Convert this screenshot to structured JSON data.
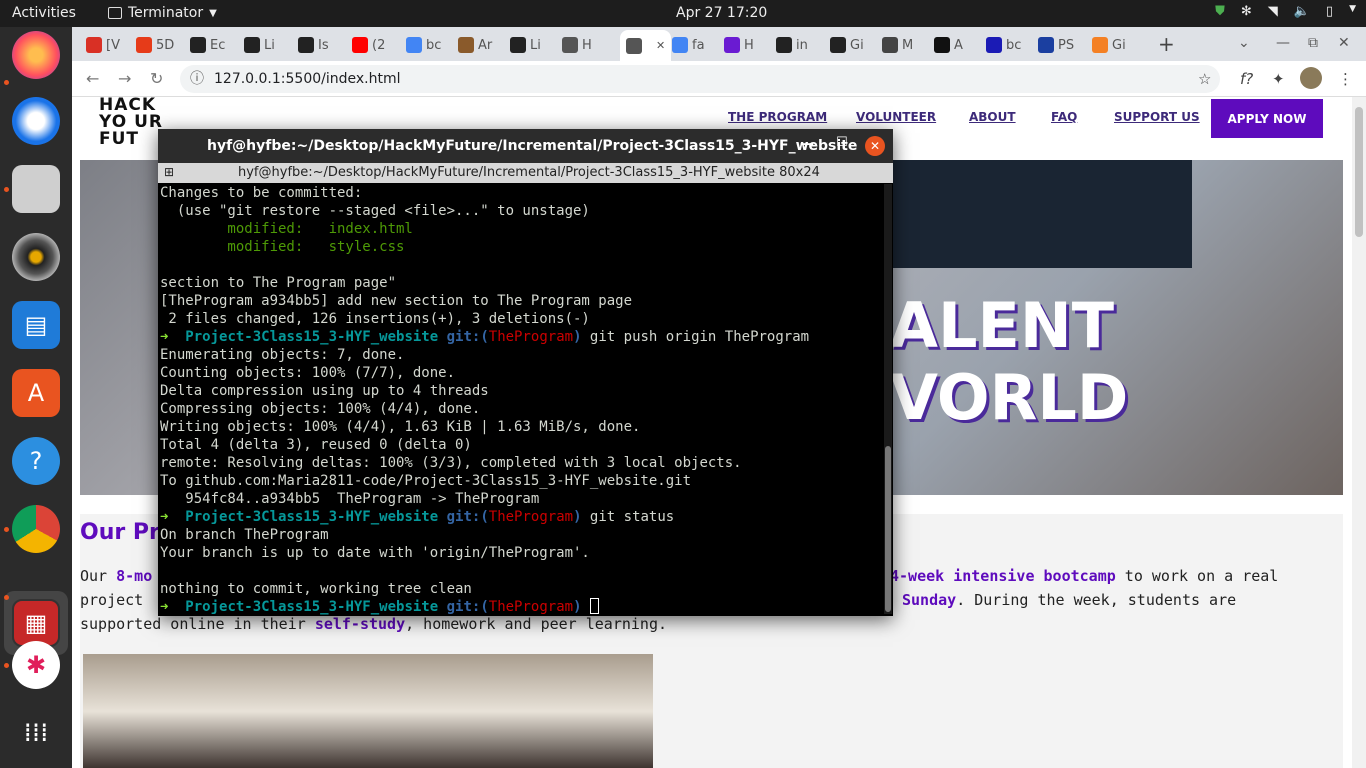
{
  "topbar": {
    "activities": "Activities",
    "app": "Terminator",
    "clock": "Apr 27  17:20"
  },
  "dock": {
    "items": [
      "firefox-icon",
      "thunderbird-icon",
      "files-icon",
      "rhythmbox-icon",
      "writer-icon",
      "software-icon",
      "help-icon",
      "chrome-icon",
      "terminator-icon",
      "slack-icon",
      "apps-grid-icon"
    ]
  },
  "browser": {
    "tabs": [
      {
        "label": "[V",
        "icon": "gmail-icon",
        "color": "#d93025"
      },
      {
        "label": "5D",
        "icon": "opera-icon",
        "color": "#e63b19"
      },
      {
        "label": "Ec",
        "icon": "github-icon",
        "color": "#222222"
      },
      {
        "label": "Li",
        "icon": "github-icon",
        "color": "#222222"
      },
      {
        "label": "Is",
        "icon": "github-icon",
        "color": "#222222"
      },
      {
        "label": "(2",
        "icon": "youtube-icon",
        "color": "#ff0000"
      },
      {
        "label": "bc",
        "icon": "google-icon",
        "color": "#4285f4"
      },
      {
        "label": "Ar",
        "icon": "bookmark-icon",
        "color": "#8a5a2b"
      },
      {
        "label": "Li",
        "icon": "p-icon",
        "color": "#222222"
      },
      {
        "label": "H",
        "icon": "globe-icon",
        "color": "#555555"
      },
      {
        "label": "",
        "icon": "globe-icon",
        "color": "#555555"
      },
      {
        "label": "fa",
        "icon": "google-icon",
        "color": "#4285f4"
      },
      {
        "label": "H",
        "icon": "video-icon",
        "color": "#6a1bd2"
      },
      {
        "label": "in",
        "icon": "github-icon",
        "color": "#222222"
      },
      {
        "label": "Gi",
        "icon": "github-icon",
        "color": "#222222"
      },
      {
        "label": "M",
        "icon": "doc-icon",
        "color": "#444444"
      },
      {
        "label": "A",
        "icon": "media-icon",
        "color": "#111111"
      },
      {
        "label": "bc",
        "icon": "bol-icon",
        "color": "#1b1bb5"
      },
      {
        "label": "PS",
        "icon": "playstation-icon",
        "color": "#1b3fa0"
      },
      {
        "label": "Gi",
        "icon": "stack-icon",
        "color": "#f48024"
      }
    ],
    "url": "127.0.0.1:5500/index.html"
  },
  "site": {
    "logo_lines": [
      "HACK",
      "YO  UR",
      "FUT"
    ],
    "nav": [
      "THE PROGRAM",
      "VOLUNTEER",
      "ABOUT",
      "FAQ",
      "SUPPORT US"
    ],
    "apply": "APPLY NOW",
    "hero_line1": "ALENT",
    "hero_line2": "VORLD",
    "section_title": "Our Pro",
    "para": {
      "l1a": "Our ",
      "l1b": "8-mo",
      "l1c": "4-week intensive bootcamp",
      "l1d": " to work on a real",
      "l2a": "project",
      "l2b": "Sunday",
      "l2c": ". During the week, students are",
      "l3a": "supported online in their ",
      "l3b": "self-study",
      "l3c": ", homework and peer learning."
    }
  },
  "terminal": {
    "title": "hyf@hyfbe:~/Desktop/HackMyFuture/Incremental/Project-3Class15_3-HYF_website",
    "subtitle": "hyf@hyfbe:~/Desktop/HackMyFuture/Incremental/Project-3Class15_3-HYF_website 80x24",
    "lines": {
      "l1": "Changes to be committed:",
      "l2": "  (use \"git restore --staged <file>...\" to unstage)",
      "l3": "        modified:   index.html",
      "l4": "        modified:   style.css",
      "l5": "",
      "l6": "section to The Program page\"",
      "l7": "[TheProgram a934bb5] add new section to The Program page",
      "l8": " 2 files changed, 126 insertions(+), 3 deletions(-)",
      "l10": "Enumerating objects: 7, done.",
      "l11": "Counting objects: 100% (7/7), done.",
      "l12": "Delta compression using up to 4 threads",
      "l13": "Compressing objects: 100% (4/4), done.",
      "l14": "Writing objects: 100% (4/4), 1.63 KiB | 1.63 MiB/s, done.",
      "l15": "Total 4 (delta 3), reused 0 (delta 0)",
      "l16": "remote: Resolving deltas: 100% (3/3), completed with 3 local objects.",
      "l17": "To github.com:Maria2811-code/Project-3Class15_3-HYF_website.git",
      "l18": "   954fc84..a934bb5  TheProgram -> TheProgram",
      "l20": "On branch TheProgram",
      "l21": "Your branch is up to date with 'origin/TheProgram'.",
      "l22": "",
      "l23": "nothing to commit, working tree clean"
    },
    "prompt": {
      "arrow": "➜",
      "dir": "Project-3Class15_3-HYF_website",
      "git": "git:(",
      "branch": "TheProgram",
      "close": ")",
      "cmd1": " git push origin TheProgram",
      "cmd2": " git status"
    }
  }
}
